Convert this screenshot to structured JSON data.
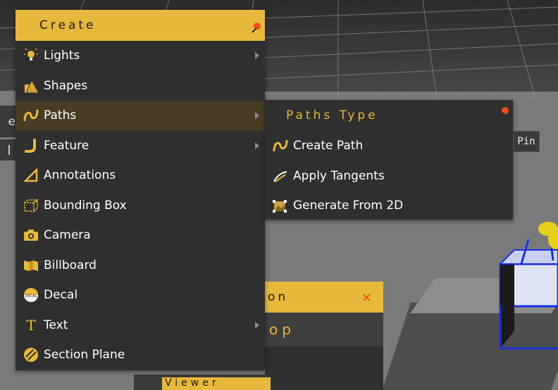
{
  "create_menu": {
    "title": "Create",
    "items": [
      {
        "label": "Lights",
        "icon": "bulb-icon",
        "submenu": true
      },
      {
        "label": "Shapes",
        "icon": "shapes-icon",
        "submenu": false
      },
      {
        "label": "Paths",
        "icon": "path-icon",
        "submenu": true,
        "active": true
      },
      {
        "label": "Feature",
        "icon": "feature-icon",
        "submenu": true
      },
      {
        "label": "Annotations",
        "icon": "annotation-icon",
        "submenu": false
      },
      {
        "label": "Bounding Box",
        "icon": "bounding-box-icon",
        "submenu": false
      },
      {
        "label": "Camera",
        "icon": "camera-icon",
        "submenu": false
      },
      {
        "label": "Billboard",
        "icon": "billboard-icon",
        "submenu": false
      },
      {
        "label": "Decal",
        "icon": "decal-icon",
        "submenu": false
      },
      {
        "label": "Text",
        "icon": "text-icon",
        "submenu": true
      },
      {
        "label": "Section Plane",
        "icon": "section-plane-icon",
        "submenu": false
      }
    ]
  },
  "paths_menu": {
    "title": "Paths Type",
    "items": [
      {
        "label": "Create Path",
        "icon": "path-icon"
      },
      {
        "label": "Apply Tangents",
        "icon": "tangent-icon"
      },
      {
        "label": "Generate From 2D",
        "icon": "generate-2d-icon"
      }
    ]
  },
  "tooltip": {
    "text": "Pin"
  },
  "background_panels": {
    "panel_header_fragment": "on",
    "panel_subheader_fragment": "op",
    "viewer_fragment": "Viewer",
    "left_fragment": "e"
  },
  "colors": {
    "accent": "#e6b83c",
    "menu_bg": "#2f2f2f",
    "active_bg": "#473c24",
    "pin": "#f04d1c"
  }
}
